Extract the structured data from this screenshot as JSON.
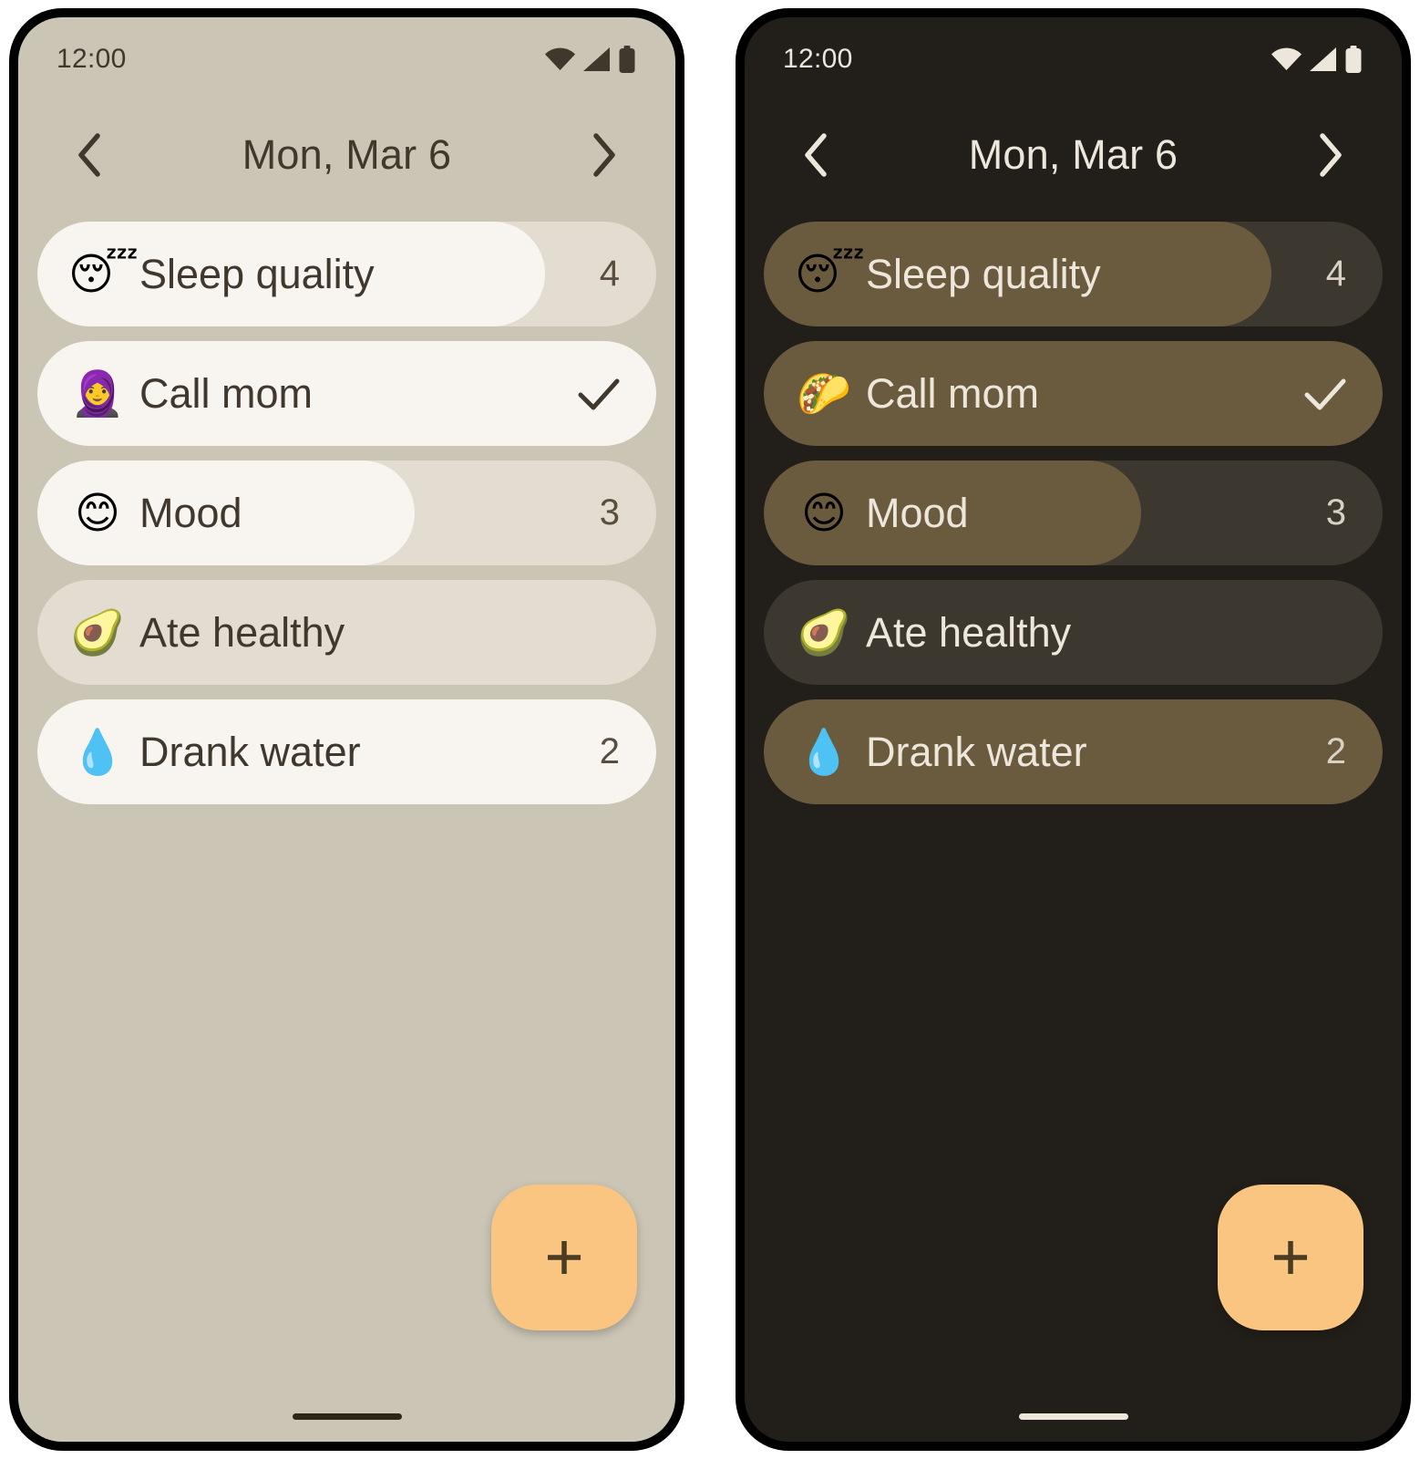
{
  "phones": [
    {
      "theme": "light",
      "status_bar": {
        "time": "12:00",
        "icons": [
          "wifi-icon",
          "cell-signal-icon",
          "battery-icon"
        ]
      },
      "header": {
        "prev_label": "chevron-left-icon",
        "title": "Mon, Mar 6",
        "next_label": "chevron-right-icon"
      },
      "habits": [
        {
          "emoji": "😴",
          "emoji_name": "sleeping-face-emoji",
          "label": "Sleep quality",
          "value": "4",
          "progress_pct": 82,
          "completed": false
        },
        {
          "emoji": "🧕",
          "emoji_name": "woman-with-headscarf-emoji",
          "label": "Call mom",
          "value": "",
          "progress_pct": 100,
          "completed": true
        },
        {
          "emoji": "😊",
          "emoji_name": "smiling-face-emoji",
          "label": "Mood",
          "value": "3",
          "progress_pct": 61,
          "completed": false
        },
        {
          "emoji": "🥑",
          "emoji_name": "avocado-emoji",
          "label": "Ate healthy",
          "value": "",
          "progress_pct": 0,
          "completed": false
        },
        {
          "emoji": "💧",
          "emoji_name": "droplet-emoji",
          "label": "Drank water",
          "value": "2",
          "progress_pct": 100,
          "completed": false
        }
      ],
      "fab": {
        "icon": "plus-icon",
        "label": "+"
      },
      "colors": {
        "background": "#CBC5B5",
        "track": "#E3DCD0",
        "fill": "#F8F4F0",
        "text": "#40382C",
        "accent": "#F9C580"
      }
    },
    {
      "theme": "dark",
      "status_bar": {
        "time": "12:00",
        "icons": [
          "wifi-icon",
          "cell-signal-icon",
          "battery-icon"
        ]
      },
      "header": {
        "prev_label": "chevron-left-icon",
        "title": "Mon, Mar 6",
        "next_label": "chevron-right-icon"
      },
      "habits": [
        {
          "emoji": "😴",
          "emoji_name": "sleeping-face-emoji",
          "label": "Sleep quality",
          "value": "4",
          "progress_pct": 82,
          "completed": false
        },
        {
          "emoji": "🌮",
          "emoji_name": "taco-emoji",
          "label": "Call mom",
          "value": "",
          "progress_pct": 100,
          "completed": true
        },
        {
          "emoji": "😊",
          "emoji_name": "smiling-face-emoji",
          "label": "Mood",
          "value": "3",
          "progress_pct": 61,
          "completed": false
        },
        {
          "emoji": "🥑",
          "emoji_name": "avocado-emoji",
          "label": "Ate healthy",
          "value": "",
          "progress_pct": 0,
          "completed": false
        },
        {
          "emoji": "💧",
          "emoji_name": "droplet-emoji",
          "label": "Drank water",
          "value": "2",
          "progress_pct": 100,
          "completed": false
        }
      ],
      "fab": {
        "icon": "plus-icon",
        "label": "+"
      },
      "colors": {
        "background": "#221F1A",
        "track": "#3C3830",
        "fill": "#6B5B3E",
        "text": "#EDE6DA",
        "accent": "#F9C580"
      }
    }
  ]
}
